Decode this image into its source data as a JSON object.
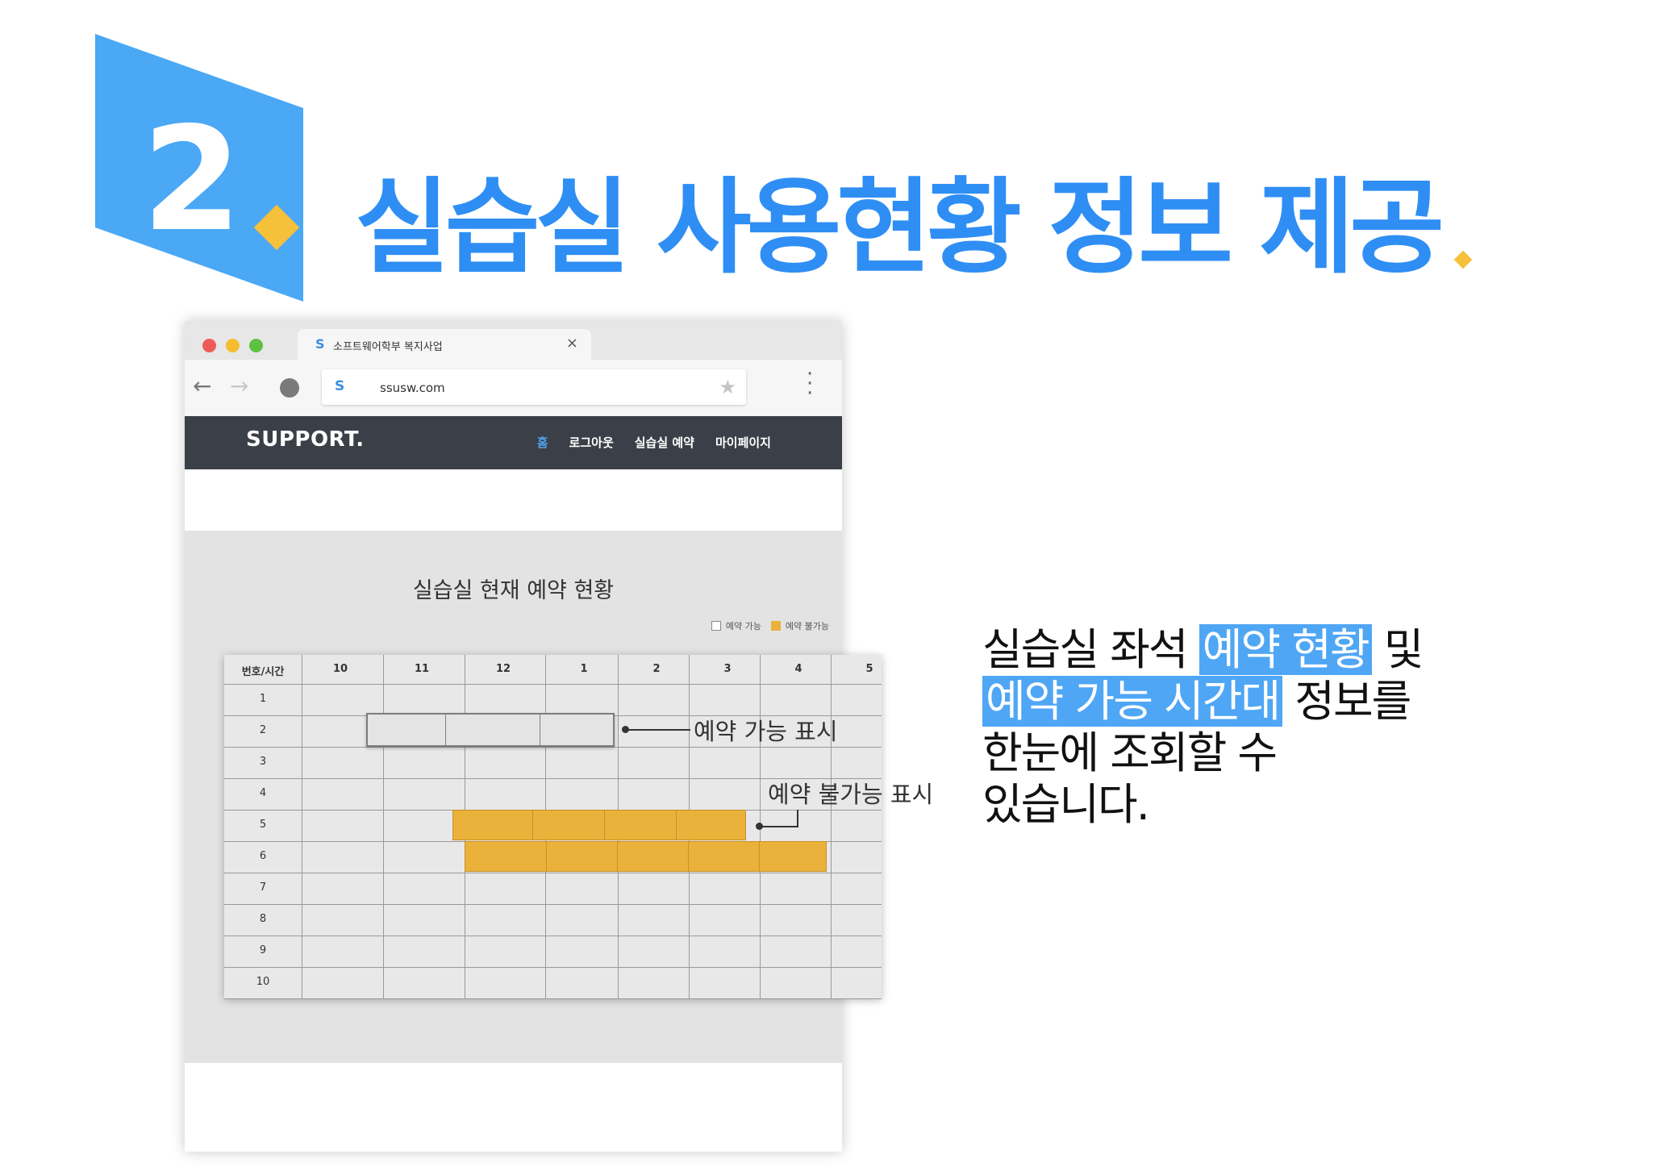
{
  "slide": {
    "number": "2",
    "title": "실습실 사용현황 정보 제공",
    "accent_color": "#2f8ef4",
    "badge_color": "#4aa8f5",
    "diamond_color": "#f5c03a"
  },
  "browser": {
    "tab": {
      "favicon": "S",
      "title": "소프트웨어학부 복지사업",
      "close_icon": "close-icon"
    },
    "toolbar": {
      "back_icon": "arrow-left-icon",
      "forward_icon": "arrow-right-icon",
      "reload_icon": "reload-icon",
      "url_favicon": "S",
      "url": "ssusw.com",
      "star_icon": "star-icon",
      "menu_icon": "kebab-menu-icon"
    }
  },
  "site": {
    "brand": "SUPPORT.",
    "menu": [
      "홈",
      "로그아웃",
      "실습실 예약",
      "마이페이지"
    ],
    "active_menu": "홈",
    "section_title": "실습실 현재 예약 현황",
    "legend": {
      "available": "예약 가능",
      "unavailable": "예약 불가능",
      "unavailable_color": "#eab23a"
    }
  },
  "table": {
    "header_label": "번호/시간",
    "times": [
      "10",
      "11",
      "12",
      "1",
      "2",
      "3",
      "4",
      "5"
    ],
    "rows": [
      "1",
      "2",
      "3",
      "4",
      "5",
      "6",
      "7",
      "8",
      "9",
      "10"
    ]
  },
  "annotations": {
    "available": "예약 가능 표시",
    "unavailable": "예약 불가능 표시"
  },
  "description": {
    "line1_a": "실습실 좌석 ",
    "line1_hl": "예약 현황",
    "line1_b": " 및",
    "line2_hl": "예약 가능 시간대",
    "line2_b": " 정보를",
    "line3": "한눈에 조회할 수",
    "line4": "있습니다."
  }
}
